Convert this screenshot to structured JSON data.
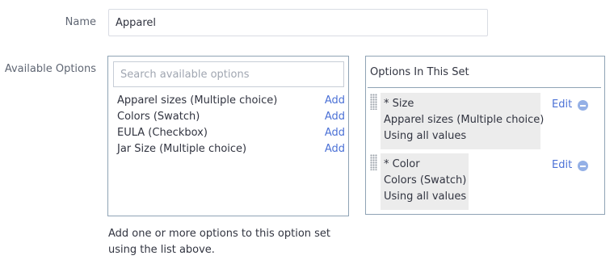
{
  "form": {
    "name_label": "Name",
    "name_value": "Apparel",
    "available_label": "Available Options",
    "help_text": "Add one or more options to this option set using the list above."
  },
  "available": {
    "search_placeholder": "Search available options",
    "add_label": "Add",
    "items": [
      {
        "name": "Apparel sizes (Multiple choice)"
      },
      {
        "name": "Colors (Swatch)"
      },
      {
        "name": "EULA (Checkbox)"
      },
      {
        "name": "Jar Size (Multiple choice)"
      }
    ]
  },
  "in_set": {
    "title": "Options In This Set",
    "edit_label": "Edit",
    "items": [
      {
        "label": "* Size",
        "option": "Apparel sizes (Multiple choice)",
        "values": "Using all values"
      },
      {
        "label": "* Color",
        "option": "Colors (Swatch)",
        "values": "Using all values"
      }
    ]
  },
  "icons": {
    "drag": "drag-handle-icon",
    "remove": "minus-circle-icon"
  },
  "colors": {
    "link": "#4b71d6",
    "panel_border": "#8fa3b5",
    "card_bg": "#ececec"
  }
}
